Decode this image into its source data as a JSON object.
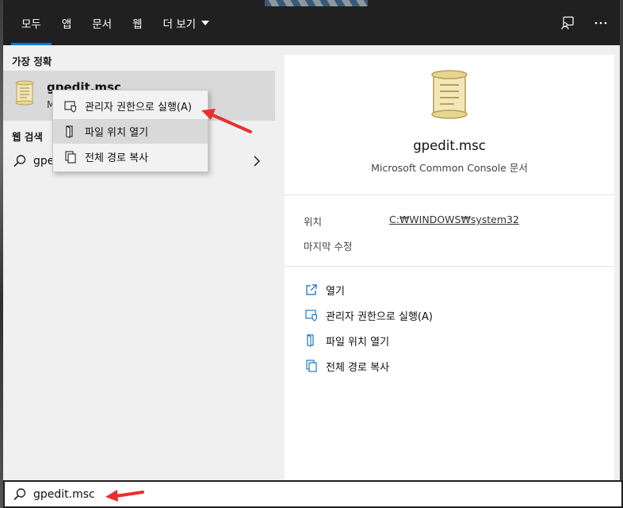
{
  "tabs": [
    {
      "label": "모두",
      "active": true
    },
    {
      "label": "앱",
      "active": false
    },
    {
      "label": "문서",
      "active": false
    },
    {
      "label": "웹",
      "active": false
    },
    {
      "label": "더 보기",
      "active": false,
      "has_dropdown": true
    }
  ],
  "top_icons": [
    "feedback-icon",
    "more-options-icon"
  ],
  "left": {
    "best_match_title": "가장 정확",
    "best_match": {
      "name": "gpedit.msc",
      "subtitle": "M",
      "icon": "scroll-file-icon"
    },
    "web_search_title": "웹 검색",
    "web_result": {
      "text": "gpe",
      "icon": "search-icon"
    }
  },
  "context_menu": {
    "items": [
      {
        "label": "관리자 권한으로 실행(A)",
        "icon": "run-as-admin-icon"
      },
      {
        "label": "파일 위치 열기",
        "icon": "open-file-location-icon",
        "highlighted": true
      },
      {
        "label": "전체 경로 복사",
        "icon": "copy-path-icon"
      }
    ]
  },
  "detail": {
    "title": "gpedit.msc",
    "subtitle": "Microsoft Common Console 문서",
    "location_label": "위치",
    "location_value": "C:₩WINDOWS₩system32",
    "modified_label": "마지막 수정",
    "actions": [
      {
        "label": "열기",
        "icon": "open-icon"
      },
      {
        "label": "관리자 권한으로 실행(A)",
        "icon": "run-as-admin-icon"
      },
      {
        "label": "파일 위치 열기",
        "icon": "open-file-location-icon"
      },
      {
        "label": "전체 경로 복사",
        "icon": "copy-path-icon"
      }
    ]
  },
  "search": {
    "value": "gpedit.msc",
    "icon": "search-icon"
  },
  "colors": {
    "accent": "#0078d7",
    "topbar": "#202020",
    "annotation_arrow": "#e8302f",
    "action_icon": "#0a6ebd"
  }
}
